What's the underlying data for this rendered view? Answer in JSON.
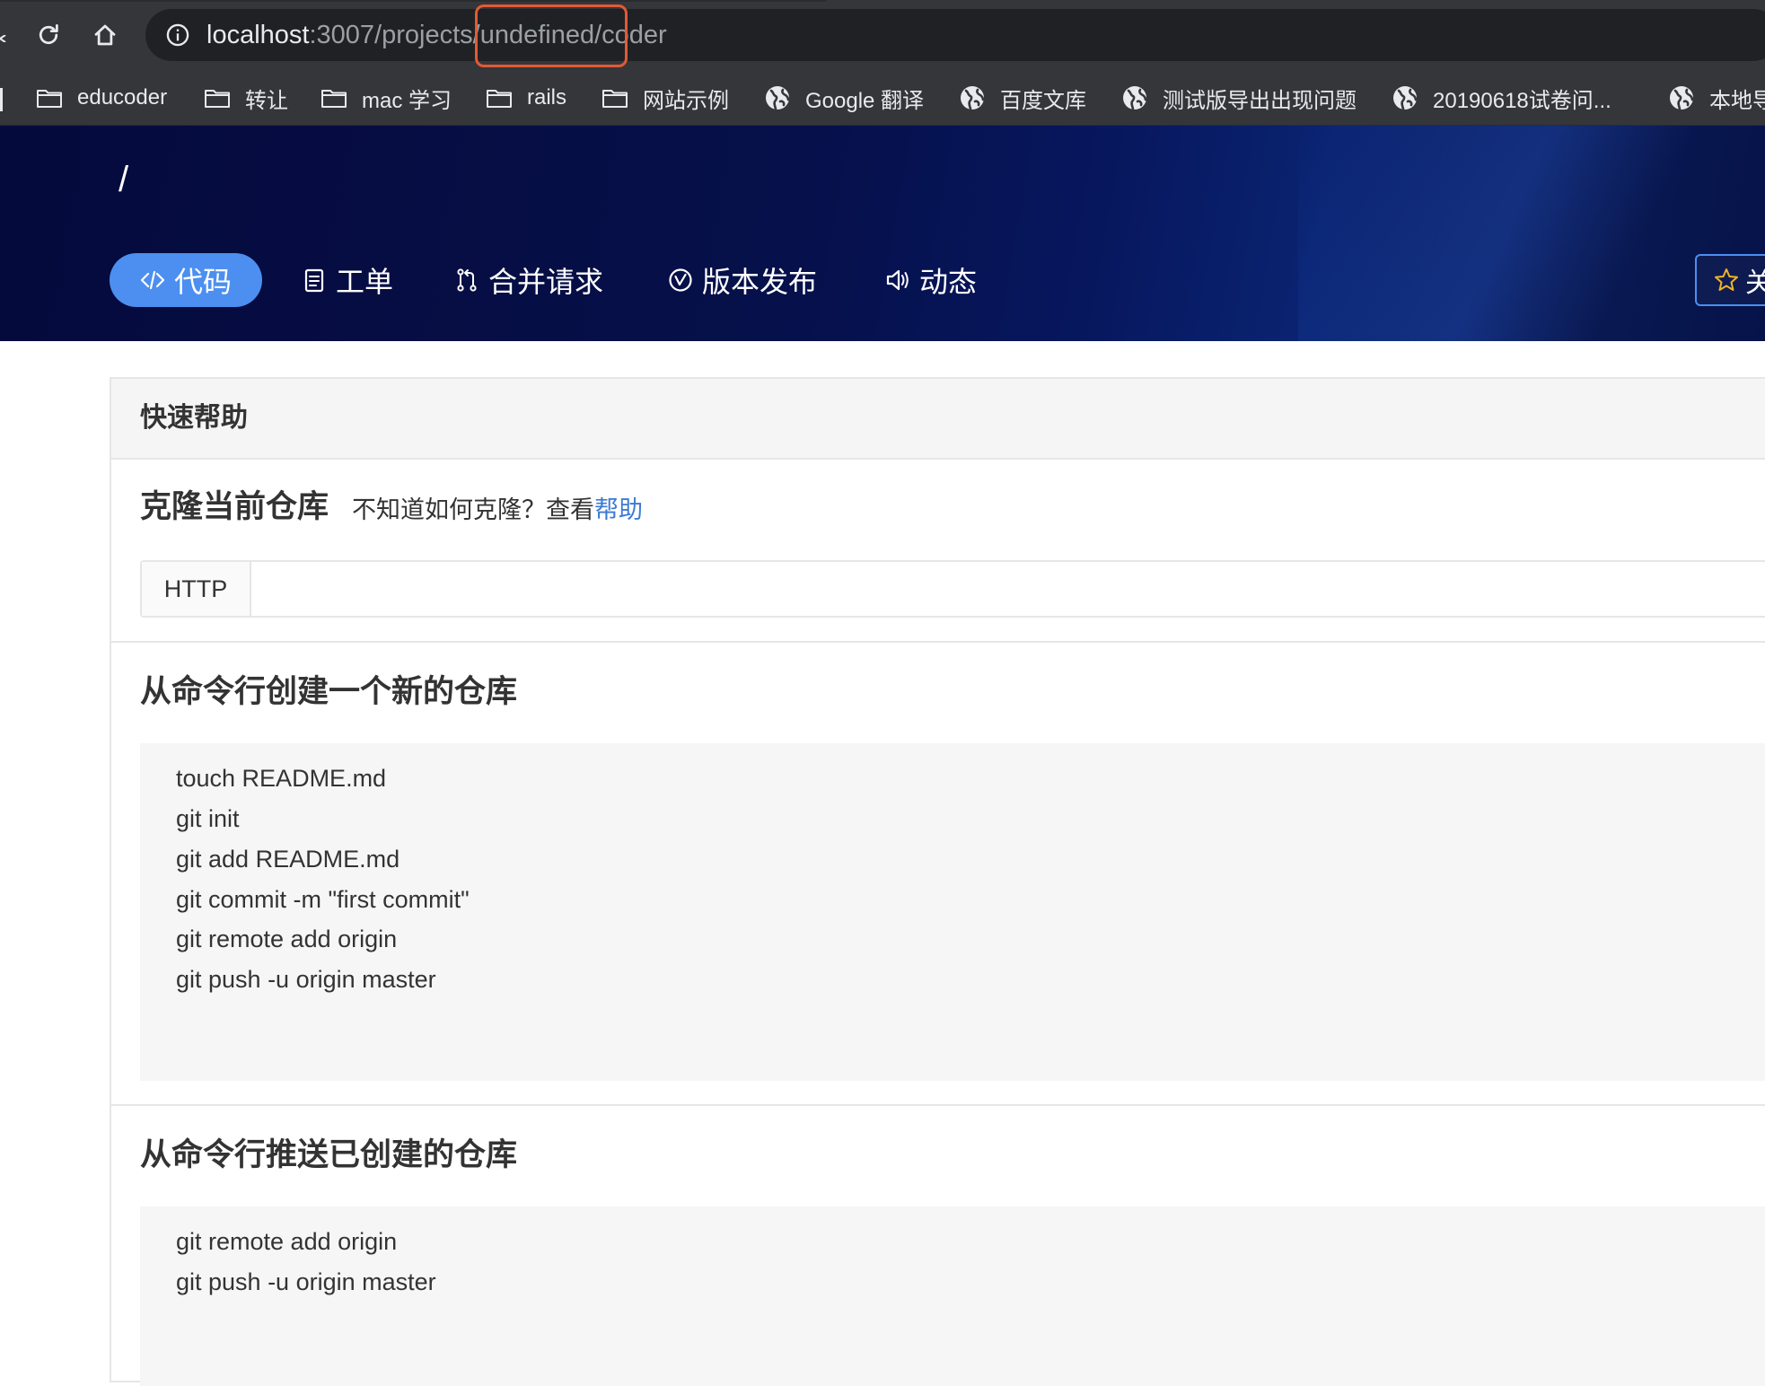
{
  "browser": {
    "url_host": "localhost",
    "url_path": ":3007/projects/undefined/coder",
    "bookmarks": [
      {
        "label": "educoder",
        "icon": "folder-icon"
      },
      {
        "label": "转让",
        "icon": "folder-icon"
      },
      {
        "label": "mac 学习",
        "icon": "folder-icon"
      },
      {
        "label": "rails",
        "icon": "folder-icon"
      },
      {
        "label": "网站示例",
        "icon": "folder-icon"
      },
      {
        "label": "Google 翻译",
        "icon": "globe-icon"
      },
      {
        "label": "百度文库",
        "icon": "globe-icon"
      },
      {
        "label": "测试版导出出现问题",
        "icon": "globe-icon"
      },
      {
        "label": "20190618试卷问...",
        "icon": "globe-icon"
      },
      {
        "label": "本地导",
        "icon": "globe-icon"
      }
    ]
  },
  "header": {
    "project_title": "/",
    "tabs": [
      {
        "label": "代码",
        "icon": "code-icon",
        "active": true
      },
      {
        "label": "工单",
        "icon": "clipboard-icon",
        "active": false
      },
      {
        "label": "合并请求",
        "icon": "merge-icon",
        "active": false
      },
      {
        "label": "版本发布",
        "icon": "check-circle-icon",
        "active": false
      },
      {
        "label": "动态",
        "icon": "speaker-icon",
        "active": false
      }
    ],
    "star_label": "关"
  },
  "help": {
    "title": "快速帮助",
    "clone": {
      "heading": "克隆当前仓库",
      "hint": "不知道如何克隆？查看",
      "hint_link": "帮助",
      "protocol": "HTTP"
    },
    "create": {
      "heading": "从命令行创建一个新的仓库",
      "lines": [
        "touch README.md",
        "git init",
        "git add README.md",
        "git commit -m \"first commit\"",
        "git remote add origin",
        "git push -u origin master"
      ]
    },
    "push": {
      "heading": "从命令行推送已创建的仓库",
      "lines": [
        "git remote add origin",
        "git push -u origin master"
      ]
    }
  },
  "colors": {
    "accent": "#4c8ff0",
    "header_bg": "#06104a",
    "link": "#3b7bd4",
    "highlight": "#e25a35"
  }
}
